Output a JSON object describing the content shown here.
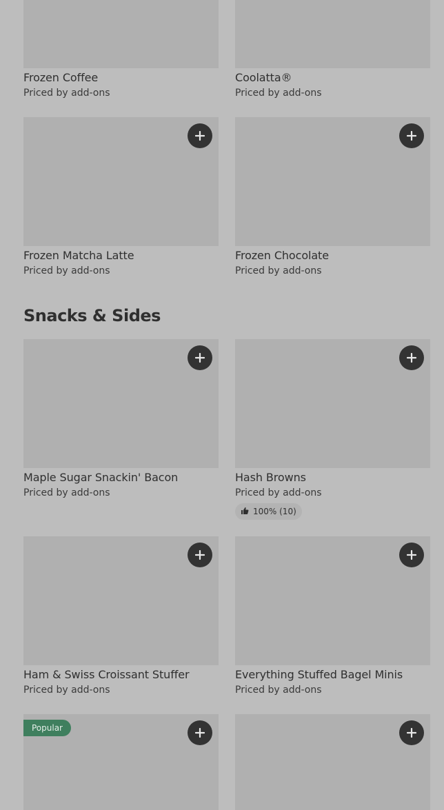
{
  "colors": {
    "page_bg": "#bdbdbd",
    "image_placeholder": "#b0b0b0",
    "add_button": "#333333",
    "popular_badge": "#3f7f5e"
  },
  "frozen_drinks": {
    "items": [
      {
        "name": "Frozen Coffee",
        "price": "Priced by add-ons"
      },
      {
        "name": "Coolatta®",
        "price": "Priced by add-ons"
      },
      {
        "name": "Frozen Matcha Latte",
        "price": "Priced by add-ons"
      },
      {
        "name": "Frozen Chocolate",
        "price": "Priced by add-ons"
      }
    ]
  },
  "snacks": {
    "title": "Snacks & Sides",
    "items": [
      {
        "name": "Maple Sugar Snackin' Bacon",
        "price": "Priced by add-ons"
      },
      {
        "name": "Hash Browns",
        "price": "Priced by add-ons",
        "rating": "100% (10)"
      },
      {
        "name": "Ham & Swiss Croissant Stuffer",
        "price": "Priced by add-ons"
      },
      {
        "name": "Everything Stuffed Bagel Minis",
        "price": "Priced by add-ons"
      }
    ],
    "popular_badge": "Popular"
  },
  "icons": {
    "add": "plus-icon",
    "rating": "thumbs-up-icon"
  }
}
